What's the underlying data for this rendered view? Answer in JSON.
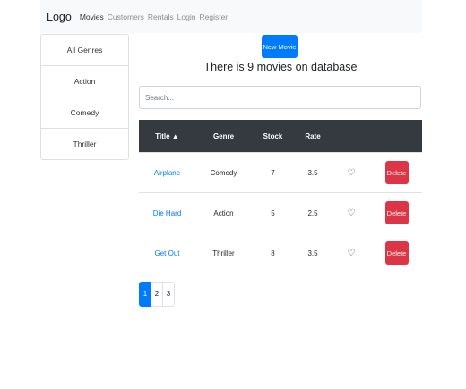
{
  "navbar": {
    "brand": "Logo",
    "links": [
      {
        "label": "Movies",
        "active": true
      },
      {
        "label": "Customers",
        "active": false
      },
      {
        "label": "Rentals",
        "active": false
      },
      {
        "label": "Login",
        "active": false
      },
      {
        "label": "Register",
        "active": false
      }
    ]
  },
  "genres": [
    "All Genres",
    "Action",
    "Comedy",
    "Thriller"
  ],
  "new_movie_label": "New Movie",
  "count_text": "There is 9 movies on database",
  "search": {
    "placeholder": "Search...",
    "value": ""
  },
  "table": {
    "headers": [
      "Title ▲",
      "Genre",
      "Stock",
      "Rate",
      "",
      ""
    ],
    "sort_column": "Title",
    "rows": [
      {
        "title": "Airplane",
        "genre": "Comedy",
        "stock": "7",
        "rate": "3.5",
        "liked": false,
        "delete_label": "Delete"
      },
      {
        "title": "Die Hard",
        "genre": "Action",
        "stock": "5",
        "rate": "2.5",
        "liked": false,
        "delete_label": "Delete"
      },
      {
        "title": "Get Out",
        "genre": "Thriller",
        "stock": "8",
        "rate": "3.5",
        "liked": false,
        "delete_label": "Delete"
      }
    ]
  },
  "pagination": {
    "pages": [
      "1",
      "2",
      "3"
    ],
    "current": "1"
  },
  "icons": {
    "like": "heart-outline-icon"
  },
  "colors": {
    "primary": "#007bff",
    "danger": "#dc3545",
    "table_header": "#343a40",
    "navbar_bg": "#f8f9fa"
  }
}
